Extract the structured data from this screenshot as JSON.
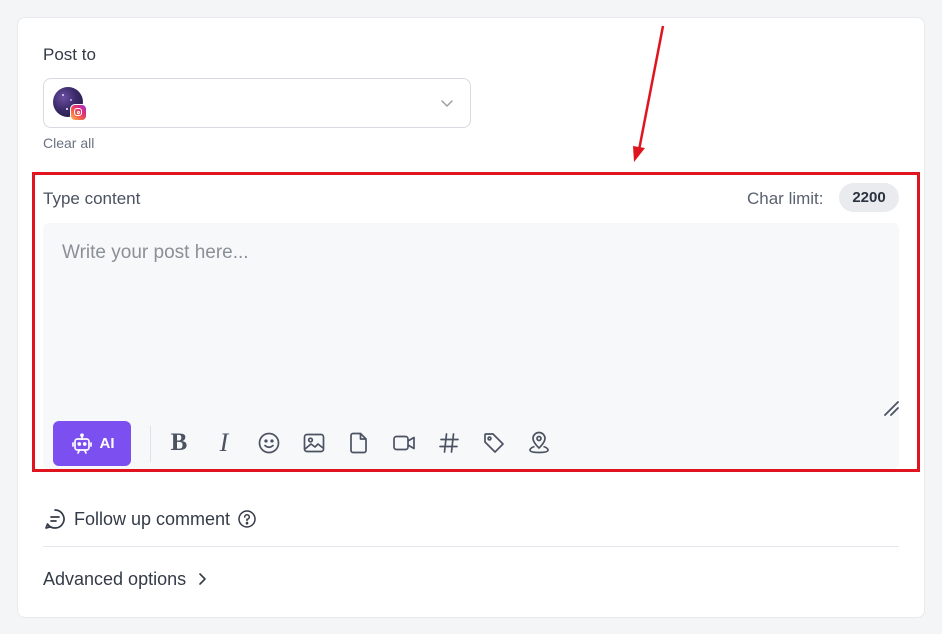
{
  "post_to": {
    "label": "Post to",
    "selected_account": {
      "avatar": "avatar",
      "network_icon": "instagram-icon"
    },
    "dropdown_icon": "chevron-down-icon",
    "clear_all_label": "Clear all"
  },
  "content": {
    "label": "Type content",
    "char_limit_label": "Char limit:",
    "char_limit_value": "2200",
    "placeholder": "Write your post here...",
    "ai_button_label": "AI",
    "toolbar": [
      "bold-icon",
      "italic-icon",
      "emoji-icon",
      "image-icon",
      "file-icon",
      "video-icon",
      "hashtag-icon",
      "tag-icon",
      "location-icon"
    ]
  },
  "follow_up": {
    "label": "Follow up comment",
    "icon": "comment-icon",
    "help_icon": "help-icon"
  },
  "advanced": {
    "label": "Advanced options",
    "icon": "chevron-right-icon"
  },
  "colors": {
    "accent": "#7b4ff0",
    "highlight": "#e0141e"
  }
}
